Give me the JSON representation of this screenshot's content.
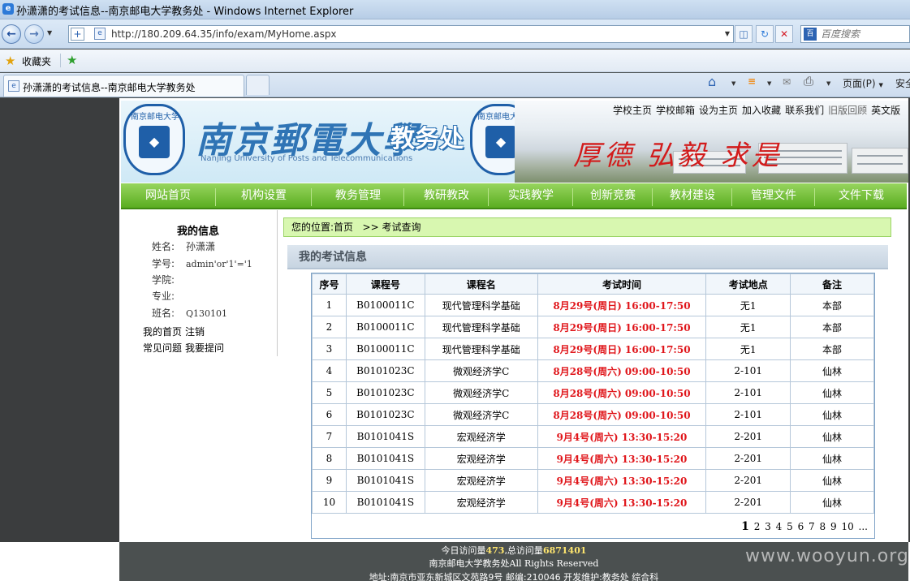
{
  "window": {
    "title": "孙潇潇的考试信息--南京邮电大学教务处 - Windows Internet Explorer"
  },
  "browser": {
    "url": "http://180.209.64.35/info/exam/MyHome.aspx",
    "search_placeholder": "百度搜索",
    "favorites_label": "收藏夹",
    "tab_title": "孙潇潇的考试信息--南京邮电大学教务处",
    "page_menu": "页面(P)",
    "safety_menu": "安全"
  },
  "banner": {
    "school": "南京郵電大學",
    "dept": "教务处",
    "english": "Nanjing University of Posts and Telecommunications",
    "seal_text": "南京邮电大学",
    "motto": "厚德 弘毅 求是",
    "top_links": [
      "学校主页",
      "学校邮箱",
      "设为主页",
      "加入收藏",
      "联系我们",
      "旧版回顾",
      "英文版"
    ]
  },
  "nav": [
    "网站首页",
    "机构设置",
    "教务管理",
    "教研教改",
    "实践教学",
    "创新竞赛",
    "教材建设",
    "管理文件",
    "文件下载"
  ],
  "sidebar": {
    "title": "我的信息",
    "fields": [
      {
        "label": "姓名:",
        "value": "孙潇潇"
      },
      {
        "label": "学号:",
        "value": "admin'or'1'='1"
      },
      {
        "label": "学院:",
        "value": ""
      },
      {
        "label": "专业:",
        "value": ""
      },
      {
        "label": "班名:",
        "value": "Q130101"
      }
    ],
    "links": [
      [
        "我的首页",
        "注销"
      ],
      [
        "常见问题",
        "我要提问"
      ]
    ]
  },
  "breadcrumb": {
    "label": "您的位置:",
    "home": "首页",
    "sep": ">>",
    "current": "考试查询"
  },
  "section_title": "我的考试信息",
  "exam_table": {
    "headers": [
      "序号",
      "课程号",
      "课程名",
      "考试时间",
      "考试地点",
      "备注"
    ],
    "rows": [
      [
        "1",
        "B0100011C",
        "现代管理科学基础",
        "8月29号(周日) 16:00-17:50",
        "无1",
        "本部"
      ],
      [
        "2",
        "B0100011C",
        "现代管理科学基础",
        "8月29号(周日) 16:00-17:50",
        "无1",
        "本部"
      ],
      [
        "3",
        "B0100011C",
        "现代管理科学基础",
        "8月29号(周日) 16:00-17:50",
        "无1",
        "本部"
      ],
      [
        "4",
        "B0101023C",
        "微观经济学C",
        "8月28号(周六) 09:00-10:50",
        "2-101",
        "仙林"
      ],
      [
        "5",
        "B0101023C",
        "微观经济学C",
        "8月28号(周六) 09:00-10:50",
        "2-101",
        "仙林"
      ],
      [
        "6",
        "B0101023C",
        "微观经济学C",
        "8月28号(周六) 09:00-10:50",
        "2-101",
        "仙林"
      ],
      [
        "7",
        "B0101041S",
        "宏观经济学",
        "9月4号(周六) 13:30-15:20",
        "2-201",
        "仙林"
      ],
      [
        "8",
        "B0101041S",
        "宏观经济学",
        "9月4号(周六) 13:30-15:20",
        "2-201",
        "仙林"
      ],
      [
        "9",
        "B0101041S",
        "宏观经济学",
        "9月4号(周六) 13:30-15:20",
        "2-201",
        "仙林"
      ],
      [
        "10",
        "B0101041S",
        "宏观经济学",
        "9月4号(周六) 13:30-15:20",
        "2-201",
        "仙林"
      ]
    ],
    "pager": {
      "current": "1",
      "pages": [
        "2",
        "3",
        "4",
        "5",
        "6",
        "7",
        "8",
        "9",
        "10",
        "..."
      ]
    }
  },
  "footer": {
    "visits_today_label": "今日访问量",
    "visits_today": "473",
    "visits_total_label": ",总访问量",
    "visits_total": "6871401",
    "copyright": "南京邮电大学教务处All Rights Reserved",
    "address": "地址:南京市亚东新城区文苑路9号      邮编:210046    开发维护:教务处 综合科"
  },
  "watermark": "www.wooyun.org",
  "colors": {
    "nav_green": "#5aad21",
    "exam_time_red": "#e0161b",
    "breadcrumb_bg": "#d8f7b0",
    "footer_bg": "#4b5050"
  }
}
